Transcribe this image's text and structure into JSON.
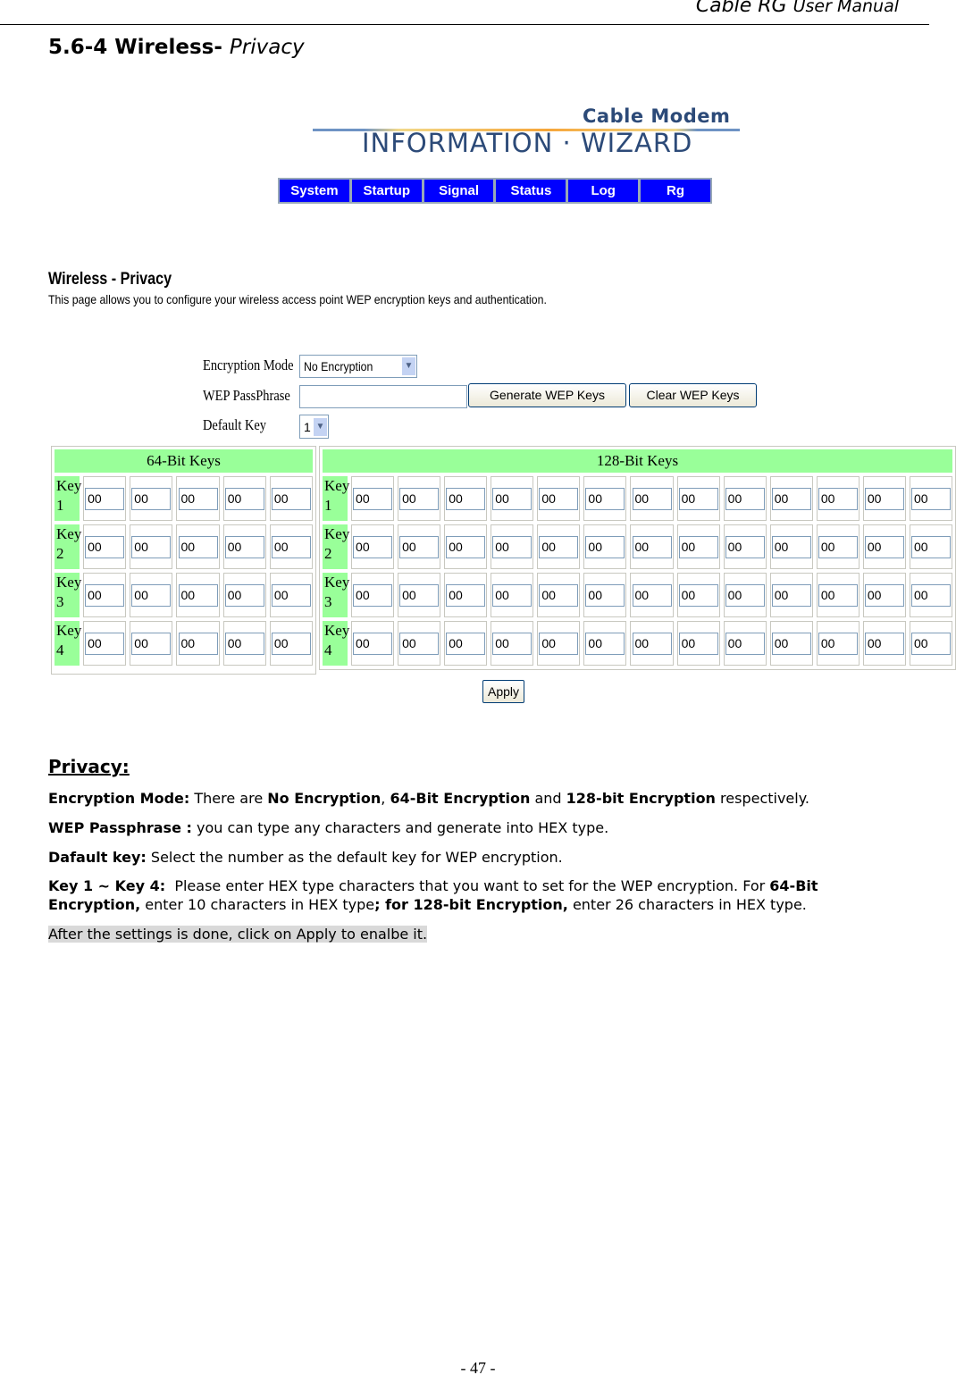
{
  "header": {
    "title": "Cable RG",
    "subtitle": "User Manual"
  },
  "section": {
    "number": "5.6-4 Wireless-",
    "name": "Privacy"
  },
  "logo": {
    "top": "Cable Modem",
    "bottom": "INFORMATION · WIZARD"
  },
  "nav": [
    "System",
    "Startup",
    "Signal",
    "Status",
    "Log",
    "Rg"
  ],
  "page": {
    "title": "Wireless - Privacy",
    "description": "This page allows you to configure your wireless access point WEP encryption keys and authentication."
  },
  "form": {
    "encryption_mode_label": "Encryption Mode",
    "encryption_mode_value": "No Encryption",
    "passphrase_label": "WEP PassPhrase",
    "passphrase_value": "",
    "generate_label": "Generate WEP Keys",
    "clear_label": "Clear WEP Keys",
    "default_key_label": "Default Key",
    "default_key_value": "1",
    "apply_label": "Apply"
  },
  "keys64": {
    "title": "64-Bit Keys",
    "rows": [
      {
        "label": "Key 1",
        "values": [
          "00",
          "00",
          "00",
          "00",
          "00"
        ]
      },
      {
        "label": "Key 2",
        "values": [
          "00",
          "00",
          "00",
          "00",
          "00"
        ]
      },
      {
        "label": "Key 3",
        "values": [
          "00",
          "00",
          "00",
          "00",
          "00"
        ]
      },
      {
        "label": "Key 4",
        "values": [
          "00",
          "00",
          "00",
          "00",
          "00"
        ]
      }
    ]
  },
  "keys128": {
    "title": "128-Bit Keys",
    "rows": [
      {
        "label": "Key 1",
        "values": [
          "00",
          "00",
          "00",
          "00",
          "00",
          "00",
          "00",
          "00",
          "00",
          "00",
          "00",
          "00",
          "00"
        ]
      },
      {
        "label": "Key 2",
        "values": [
          "00",
          "00",
          "00",
          "00",
          "00",
          "00",
          "00",
          "00",
          "00",
          "00",
          "00",
          "00",
          "00"
        ]
      },
      {
        "label": "Key 3",
        "values": [
          "00",
          "00",
          "00",
          "00",
          "00",
          "00",
          "00",
          "00",
          "00",
          "00",
          "00",
          "00",
          "00"
        ]
      },
      {
        "label": "Key 4",
        "values": [
          "00",
          "00",
          "00",
          "00",
          "00",
          "00",
          "00",
          "00",
          "00",
          "00",
          "00",
          "00",
          "00"
        ]
      }
    ]
  },
  "privacy": {
    "heading": "Privacy:",
    "paragraphs": [
      [
        {
          "t": "Encryption Mode:",
          "b": true
        },
        {
          "t": " There are "
        },
        {
          "t": "No Encryption",
          "b": true
        },
        {
          "t": ", "
        },
        {
          "t": "64-Bit Encryption",
          "b": true
        },
        {
          "t": " and "
        },
        {
          "t": "128-bit Encryption",
          "b": true
        },
        {
          "t": " respectively."
        }
      ],
      [
        {
          "t": "WEP Passphrase :",
          "b": true
        },
        {
          "t": " you can type any characters and generate into HEX type."
        }
      ],
      [
        {
          "t": "Dafault key:",
          "b": true
        },
        {
          "t": " Select the number as the default key for WEP encryption."
        }
      ],
      [
        {
          "t": "Key 1 ~ Key 4:",
          "b": true
        },
        {
          "t": "  Please enter HEX type characters that you want to set for the WEP encryption. For "
        },
        {
          "t": "64-Bit Encryption,",
          "b": true
        },
        {
          "t": " enter 10 characters in HEX type"
        },
        {
          "t": "; for 128-bit Encryption,",
          "b": true
        },
        {
          "t": " enter 26 characters in HEX type."
        }
      ]
    ],
    "note": "After the settings is done, click on Apply to enalbe it."
  },
  "page_number": "- 47 -"
}
